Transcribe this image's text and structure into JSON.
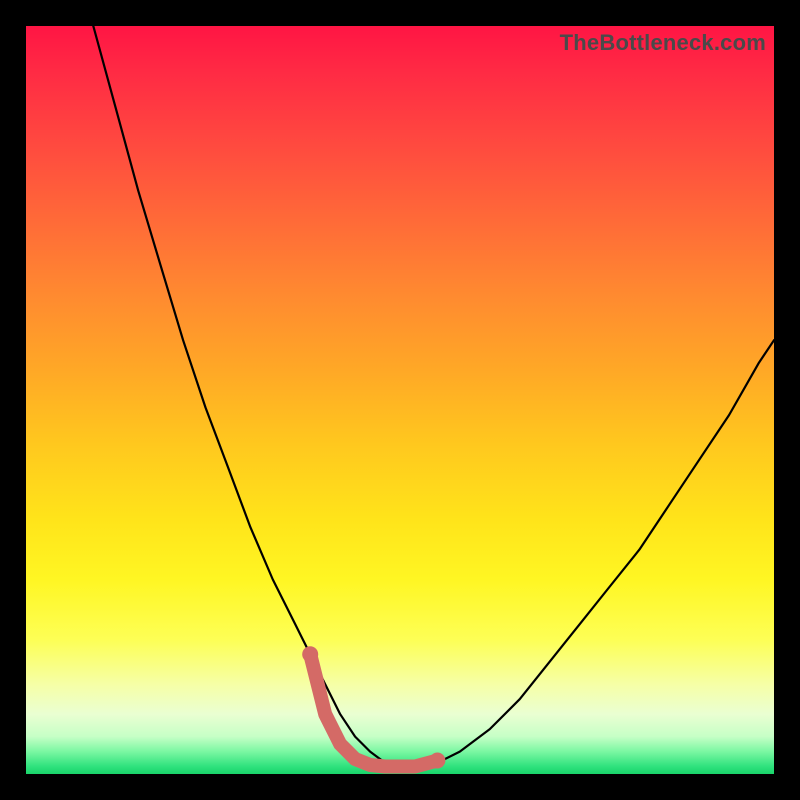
{
  "watermark": "TheBottleneck.com",
  "colors": {
    "frame": "#000000",
    "curve": "#000000",
    "marker": "#d46a66",
    "gradient_top": "#ff1544",
    "gradient_bottom": "#19d46a"
  },
  "chart_data": {
    "type": "line",
    "title": "",
    "xlabel": "",
    "ylabel": "",
    "xlim": [
      0,
      100
    ],
    "ylim": [
      0,
      100
    ],
    "series": [
      {
        "name": "bottleneck-curve",
        "x": [
          9,
          12,
          15,
          18,
          21,
          24,
          27,
          30,
          33,
          36,
          38,
          40,
          42,
          44,
          46,
          48,
          50,
          52,
          55,
          58,
          62,
          66,
          70,
          74,
          78,
          82,
          86,
          90,
          94,
          98,
          100
        ],
        "values": [
          100,
          89,
          78,
          68,
          58,
          49,
          41,
          33,
          26,
          20,
          16,
          12,
          8,
          5,
          3,
          1.5,
          1,
          1,
          1.5,
          3,
          6,
          10,
          15,
          20,
          25,
          30,
          36,
          42,
          48,
          55,
          58
        ]
      }
    ],
    "markers": {
      "name": "optimal-range",
      "x": [
        38,
        40,
        42,
        44,
        46,
        48,
        50,
        52,
        55
      ],
      "values": [
        16,
        8,
        4,
        2,
        1.2,
        1,
        1,
        1,
        1.8
      ]
    }
  }
}
